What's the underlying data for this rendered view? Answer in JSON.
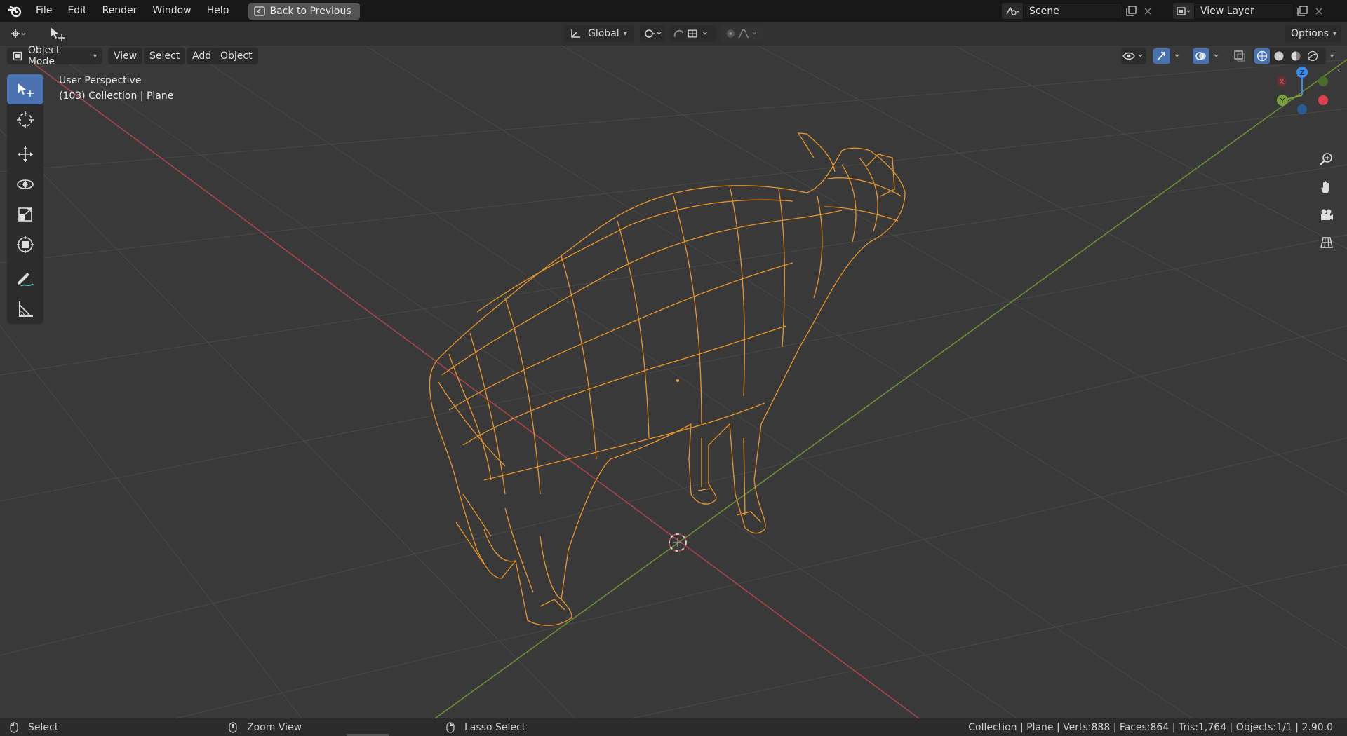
{
  "menubar": {
    "items": [
      "File",
      "Edit",
      "Render",
      "Window",
      "Help"
    ],
    "back_button": "Back to Previous",
    "scene_value": "Scene",
    "view_layer_value": "View Layer"
  },
  "tool_header": {
    "orientation": "Global",
    "options_label": "Options"
  },
  "viewport_header": {
    "mode": "Object Mode",
    "menus": [
      "View",
      "Select",
      "Add",
      "Object"
    ]
  },
  "viewport": {
    "view_name": "User Perspective",
    "collection_info": "(103) Collection | Plane",
    "gizmo_axes": {
      "x": "X",
      "y": "Y",
      "z": "Z"
    }
  },
  "statusbar": {
    "left_action": "Select",
    "middle_action": "Zoom View",
    "right_action": "Lasso Select",
    "stats": "Collection | Plane | Verts:888 | Faces:864 | Tris:1,764 | Objects:1/1 | 2.90.0"
  },
  "colors": {
    "accent_blue": "#4a72b0",
    "selection_orange": "#f0a030",
    "axis_x": "#c8505a",
    "axis_y": "#7ca040",
    "axis_z": "#3d8be8"
  },
  "icons": [
    "blender-logo",
    "back-icon",
    "scene-icon",
    "viewlayer-icon",
    "copy-icon",
    "close-icon",
    "editor-type-icon",
    "select-tool-icon",
    "cursor-icon",
    "move-icon",
    "rotate-icon",
    "scale-icon",
    "transform-icon",
    "annotate-icon",
    "measure-icon",
    "zoom-icon",
    "pan-hand-icon",
    "camera-icon",
    "grid-icon"
  ]
}
